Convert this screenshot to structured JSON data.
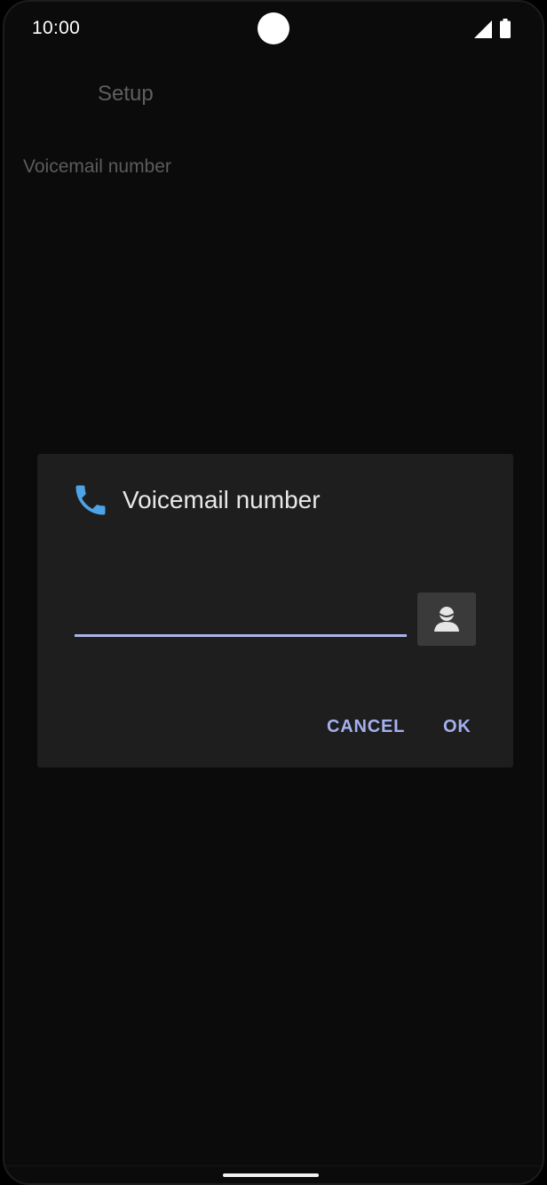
{
  "status_bar": {
    "time": "10:00",
    "signal_icon": "cellular-signal-icon",
    "battery_icon": "battery-full-icon"
  },
  "app_bar": {
    "title": "Setup"
  },
  "preference": {
    "label": "Voicemail number"
  },
  "dialog": {
    "icon": "phone-icon",
    "title": "Voicemail number",
    "input": {
      "value": "",
      "placeholder": ""
    },
    "contact_picker_icon": "contact-icon",
    "cancel_label": "CANCEL",
    "ok_label": "OK"
  },
  "colors": {
    "accent": "#a5b0ef",
    "phone_icon": "#4ea3e6",
    "dialog_bg": "#1e1e1e",
    "screen_bg": "#0b0b0b"
  }
}
